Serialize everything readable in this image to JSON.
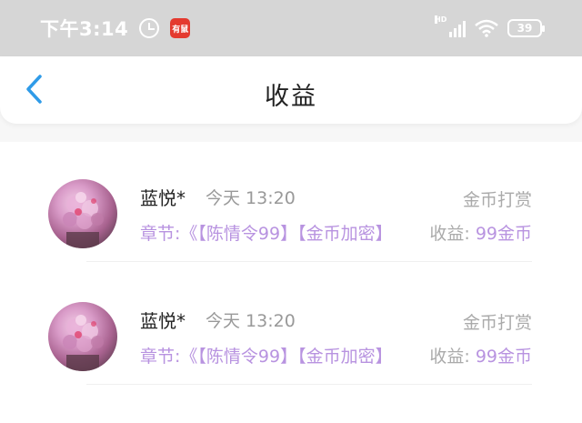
{
  "status_bar": {
    "time": "下午3:14",
    "app_icon_text": "有鼠",
    "network": "HD",
    "battery": "39"
  },
  "header": {
    "title": "收益",
    "back_icon": "chevron-left-icon"
  },
  "colors": {
    "accent": "#2f9be8",
    "purple": "#b893e0",
    "gray": "#999999"
  },
  "items": [
    {
      "name": "蓝悦*",
      "time": "今天 13:20",
      "type": "金币打赏",
      "chapter": "章节:《【陈情令99】【金币加密】",
      "income_label": "收益:",
      "income_value": "99金币"
    },
    {
      "name": "蓝悦*",
      "time": "今天 13:20",
      "type": "金币打赏",
      "chapter": "章节:《【陈情令99】【金币加密】",
      "income_label": "收益:",
      "income_value": "99金币"
    }
  ]
}
